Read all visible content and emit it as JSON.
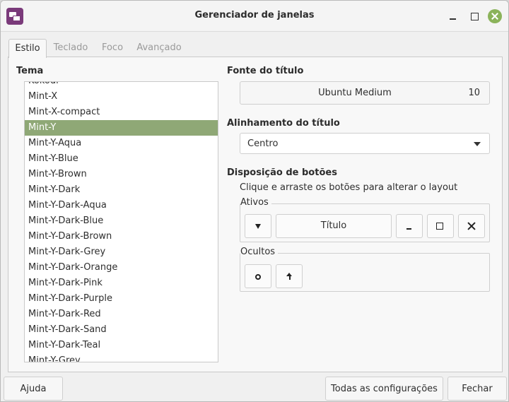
{
  "window": {
    "title": "Gerenciador de janelas",
    "colors": {
      "accent": "#8fa876",
      "close_button": "#8bb35a",
      "app_icon": "#7a3a7a"
    }
  },
  "tabs": [
    {
      "label": "Estilo",
      "active": true
    },
    {
      "label": "Teclado",
      "active": false
    },
    {
      "label": "Foco",
      "active": false
    },
    {
      "label": "Avançado",
      "active": false
    }
  ],
  "theme": {
    "label": "Tema",
    "items": [
      "Kokodi",
      "Mint-X",
      "Mint-X-compact",
      "Mint-Y",
      "Mint-Y-Aqua",
      "Mint-Y-Blue",
      "Mint-Y-Brown",
      "Mint-Y-Dark",
      "Mint-Y-Dark-Aqua",
      "Mint-Y-Dark-Blue",
      "Mint-Y-Dark-Brown",
      "Mint-Y-Dark-Grey",
      "Mint-Y-Dark-Orange",
      "Mint-Y-Dark-Pink",
      "Mint-Y-Dark-Purple",
      "Mint-Y-Dark-Red",
      "Mint-Y-Dark-Sand",
      "Mint-Y-Dark-Teal",
      "Mint-Y-Grey"
    ],
    "selected": "Mint-Y"
  },
  "title_font": {
    "label": "Fonte do título",
    "font_name": "Ubuntu Medium",
    "font_size": "10"
  },
  "title_alignment": {
    "label": "Alinhamento do título",
    "value": "Centro"
  },
  "button_layout": {
    "label": "Disposição de botões",
    "hint": "Clique e arraste os botões para alterar o layout",
    "active_label": "Ativos",
    "title_button": "Título",
    "hidden_label": "Ocultos"
  },
  "footer": {
    "help": "Ajuda",
    "all_settings": "Todas as configurações",
    "close": "Fechar"
  }
}
